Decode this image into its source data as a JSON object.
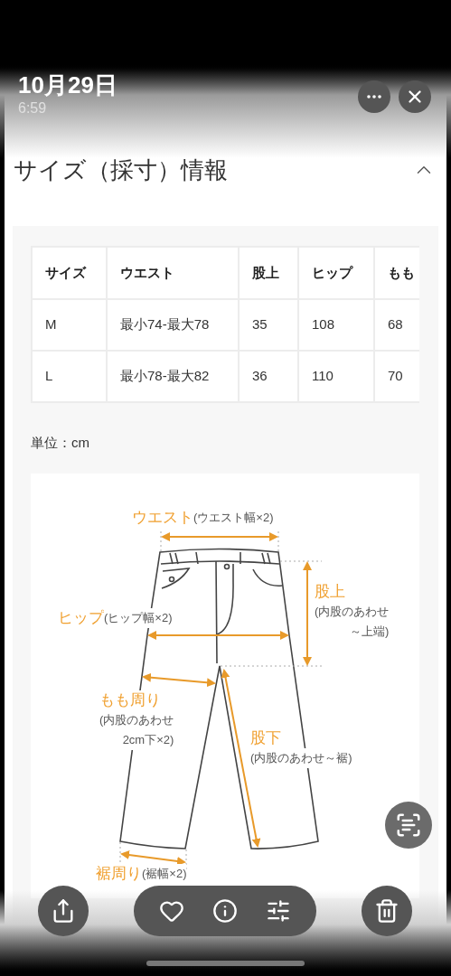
{
  "header": {
    "date": "10月29日",
    "time": "6:59"
  },
  "section": {
    "title": "サイズ（採寸）情報",
    "expanded": true
  },
  "table": {
    "columns": [
      "サイズ",
      "ウエスト",
      "股上",
      "ヒップ",
      "もも"
    ],
    "rows": [
      {
        "cells": [
          "M",
          "最小74-最大78",
          "35",
          "108",
          "68"
        ]
      },
      {
        "cells": [
          "L",
          "最小78-最大82",
          "36",
          "110",
          "70"
        ]
      }
    ]
  },
  "unit": "単位：cm",
  "diagram": {
    "labels": [
      {
        "term": "ウエスト",
        "notes": [
          "(ウエスト幅×2)"
        ]
      },
      {
        "term": "ヒップ",
        "notes": [
          "(ヒップ幅×2)"
        ]
      },
      {
        "term": "股上",
        "notes": [
          "(内股のあわせ",
          "～上端)"
        ]
      },
      {
        "term": "もも周り",
        "notes": [
          "(内股のあわせ",
          "2cm下×2)"
        ]
      },
      {
        "term": "股下",
        "notes": [
          "(内股のあわせ～裾)"
        ]
      },
      {
        "term": "裾周り",
        "notes": [
          "(裾幅×2)"
        ]
      }
    ]
  },
  "toolbar": {
    "favorite": false
  }
}
